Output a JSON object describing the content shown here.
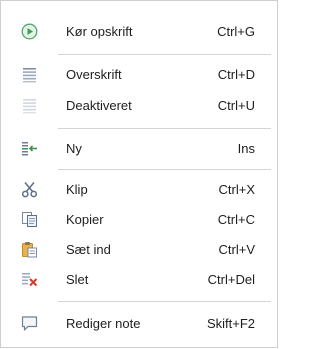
{
  "menu": {
    "items": [
      {
        "label": "Kør opskrift",
        "shortcut": "Ctrl+G",
        "icon": "play-icon"
      },
      {
        "label": "Overskrift",
        "shortcut": "Ctrl+D",
        "icon": "heading-lines-icon"
      },
      {
        "label": "Deaktiveret",
        "shortcut": "Ctrl+U",
        "icon": "disabled-lines-icon"
      },
      {
        "label": "Ny",
        "shortcut": "Ins",
        "icon": "insert-line-icon"
      },
      {
        "label": "Klip",
        "shortcut": "Ctrl+X",
        "icon": "scissors-icon"
      },
      {
        "label": "Kopier",
        "shortcut": "Ctrl+C",
        "icon": "copy-icon"
      },
      {
        "label": "Sæt ind",
        "shortcut": "Ctrl+V",
        "icon": "paste-icon"
      },
      {
        "label": "Slet",
        "shortcut": "Ctrl+Del",
        "icon": "delete-icon"
      },
      {
        "label": "Rediger note",
        "shortcut": "Skift+F2",
        "icon": "note-icon"
      }
    ]
  }
}
